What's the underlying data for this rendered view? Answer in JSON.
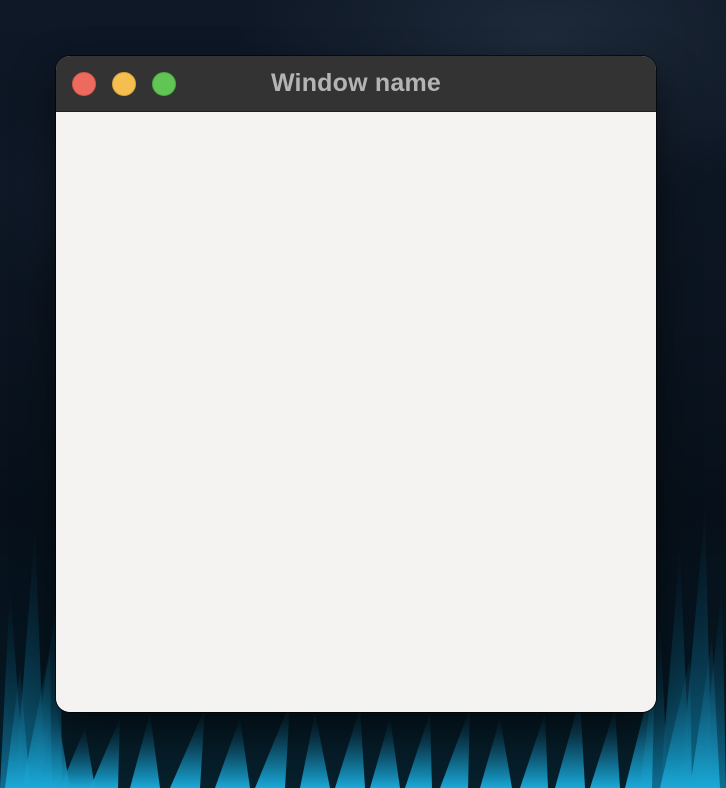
{
  "window": {
    "title": "Window name"
  },
  "controls": {
    "close_color": "#ed6a5e",
    "minimize_color": "#f5bf4f",
    "maximize_color": "#61c554"
  },
  "colors": {
    "titlebar": "#333333",
    "content": "#f4f3f1",
    "title_text": "#b4b4b4"
  },
  "icons": [
    "close-icon",
    "minimize-icon",
    "maximize-icon"
  ]
}
